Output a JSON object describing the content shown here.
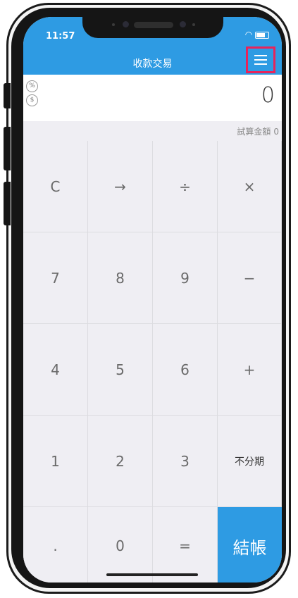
{
  "status_bar": {
    "time": "11:57"
  },
  "header": {
    "title": "收款交易"
  },
  "display": {
    "percent_icon": "%",
    "dollar_icon": "$",
    "amount": "0",
    "trial_label": "試算金額",
    "trial_value": "0"
  },
  "keys": {
    "clear": "C",
    "arrow": "→",
    "divide": "÷",
    "multiply": "×",
    "seven": "7",
    "eight": "8",
    "nine": "9",
    "minus": "−",
    "four": "4",
    "five": "5",
    "six": "6",
    "plus": "+",
    "one": "1",
    "two": "2",
    "three": "3",
    "no_installment": "不分期",
    "dot": ".",
    "zero": "0",
    "equals": "=",
    "checkout": "結帳"
  },
  "colors": {
    "accent": "#2e9be3",
    "highlight": "#e8245b"
  }
}
